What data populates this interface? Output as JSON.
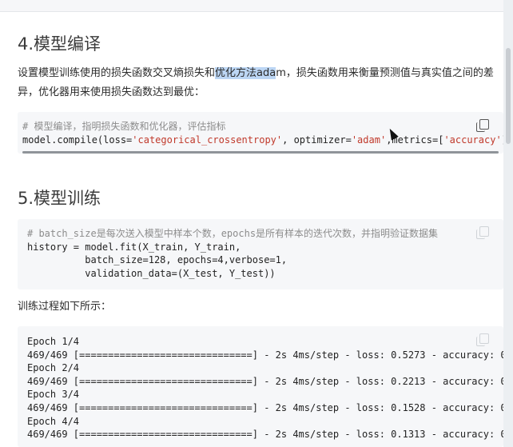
{
  "section_compile": {
    "heading": "4.模型编译"
  },
  "para_compile": {
    "before": "设置模型训练使用的损失函数交叉熵损失和",
    "highlight": "优化方法ada",
    "after": "m，损失函数用来衡量预测值与真实值之间的差异，优化器用来使用损失函数达到最优："
  },
  "code_compile": {
    "comment": "# 模型编译，指明损失函数和优化器，评估指标",
    "line_a": "model.compile(loss=",
    "loss_str": "'categorical_crossentropy'",
    "line_b": ", optimizer=",
    "opt_str": "'adam'",
    "line_c": ",metrics=[",
    "metric_str": "'accuracy'",
    "line_d": "])"
  },
  "section_train": {
    "heading": "5.模型训练"
  },
  "code_train": {
    "comment": "# batch_size是每次送入模型中样本个数，epochs是所有样本的迭代次数，并指明验证数据集",
    "line1": "history = model.fit(X_train, Y_train,",
    "line2": "          batch_size=128, epochs=4,verbose=1,",
    "line3": "          validation_data=(X_test, Y_test))"
  },
  "para_train": {
    "text": "训练过程如下所示："
  },
  "code_output": {
    "lines": [
      "Epoch 1/4",
      "469/469 [==============================] - 2s 4ms/step - loss: 0.5273 - accuracy: 0",
      "Epoch 2/4",
      "469/469 [==============================] - 2s 4ms/step - loss: 0.2213 - accuracy: 0",
      "Epoch 3/4",
      "469/469 [==============================] - 2s 4ms/step - loss: 0.1528 - accuracy: 0",
      "Epoch 4/4",
      "469/469 [==============================] - 2s 4ms/step - loss: 0.1313 - accuracy: 0"
    ]
  },
  "icons": {
    "copy": "copy-icon",
    "cursor": "mouse-cursor-icon"
  },
  "colors": {
    "code_bg": "#f6f7f9",
    "string": "#c0392b",
    "comment": "#8c8c8c",
    "highlight": "#bcd6f4"
  }
}
